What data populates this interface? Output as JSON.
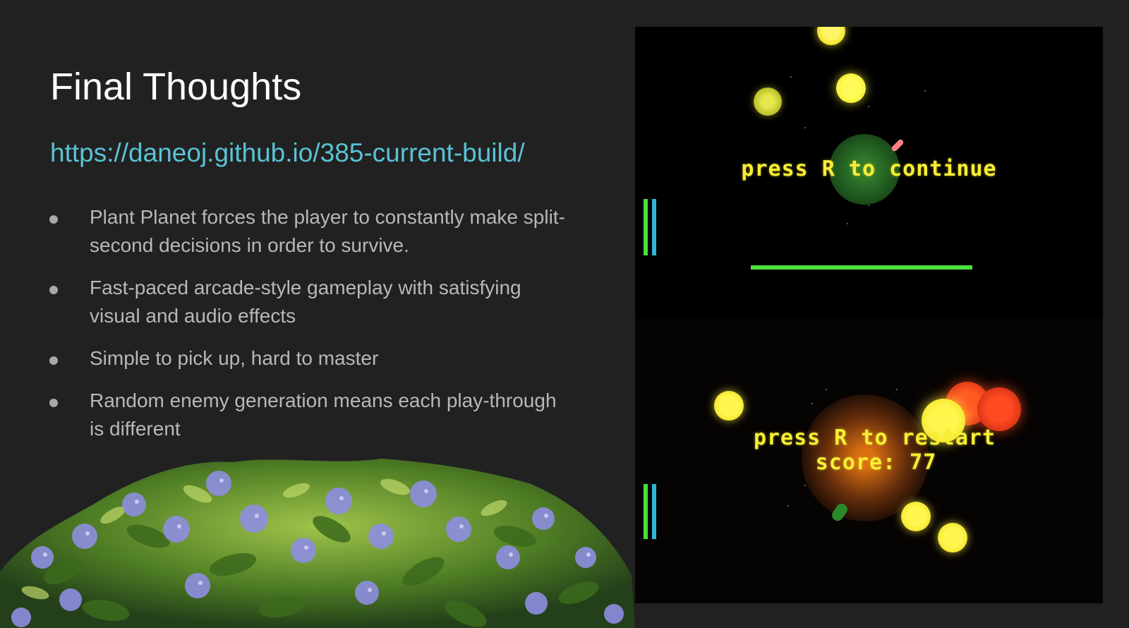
{
  "slide": {
    "title": "Final Thoughts",
    "link": "https://daneoj.github.io/385-current-build/",
    "bullets": [
      "Plant Planet forces the player to constantly make split-second decisions in order to survive.",
      "Fast-paced arcade-style gameplay with satisfying visual and audio effects",
      "Simple to pick up, hard to master",
      "Random enemy generation means each play-through is different"
    ]
  },
  "screenshots": {
    "top": {
      "message": "press R to continue"
    },
    "bottom": {
      "message": "press R to restart",
      "score_line": "score: 77"
    }
  },
  "colors": {
    "background": "#212121",
    "title": "#ffffff",
    "link": "#5ac2d6",
    "bullet_text": "#b8b8b8",
    "game_text": "#f6ee34",
    "player_bar_green": "#4be03b",
    "player_bar_blue": "#2fb6d8"
  }
}
